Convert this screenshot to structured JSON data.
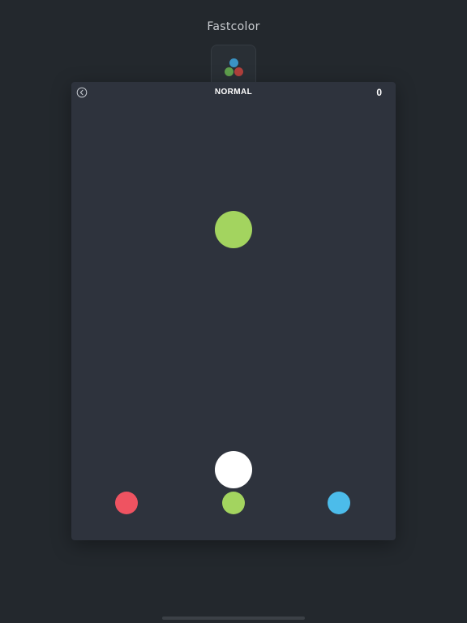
{
  "app": {
    "title": "Fastcolor",
    "icon": "three-dots-logo-icon"
  },
  "game": {
    "mode": "NORMAL",
    "score": "0",
    "back_icon": "back-chevron-circle-icon",
    "falling_ball_color": "#a3d45f",
    "player_ball_color": "#ffffff",
    "color_options": [
      {
        "name": "red",
        "color": "#ef5361"
      },
      {
        "name": "green",
        "color": "#a3d45f"
      },
      {
        "name": "blue",
        "color": "#4cbcea"
      }
    ]
  },
  "colors": {
    "background": "#23282d",
    "panel": "#2e333d",
    "icon_blue": "#3a93c4",
    "icon_green": "#5e9e4c",
    "icon_red": "#b0403c"
  }
}
